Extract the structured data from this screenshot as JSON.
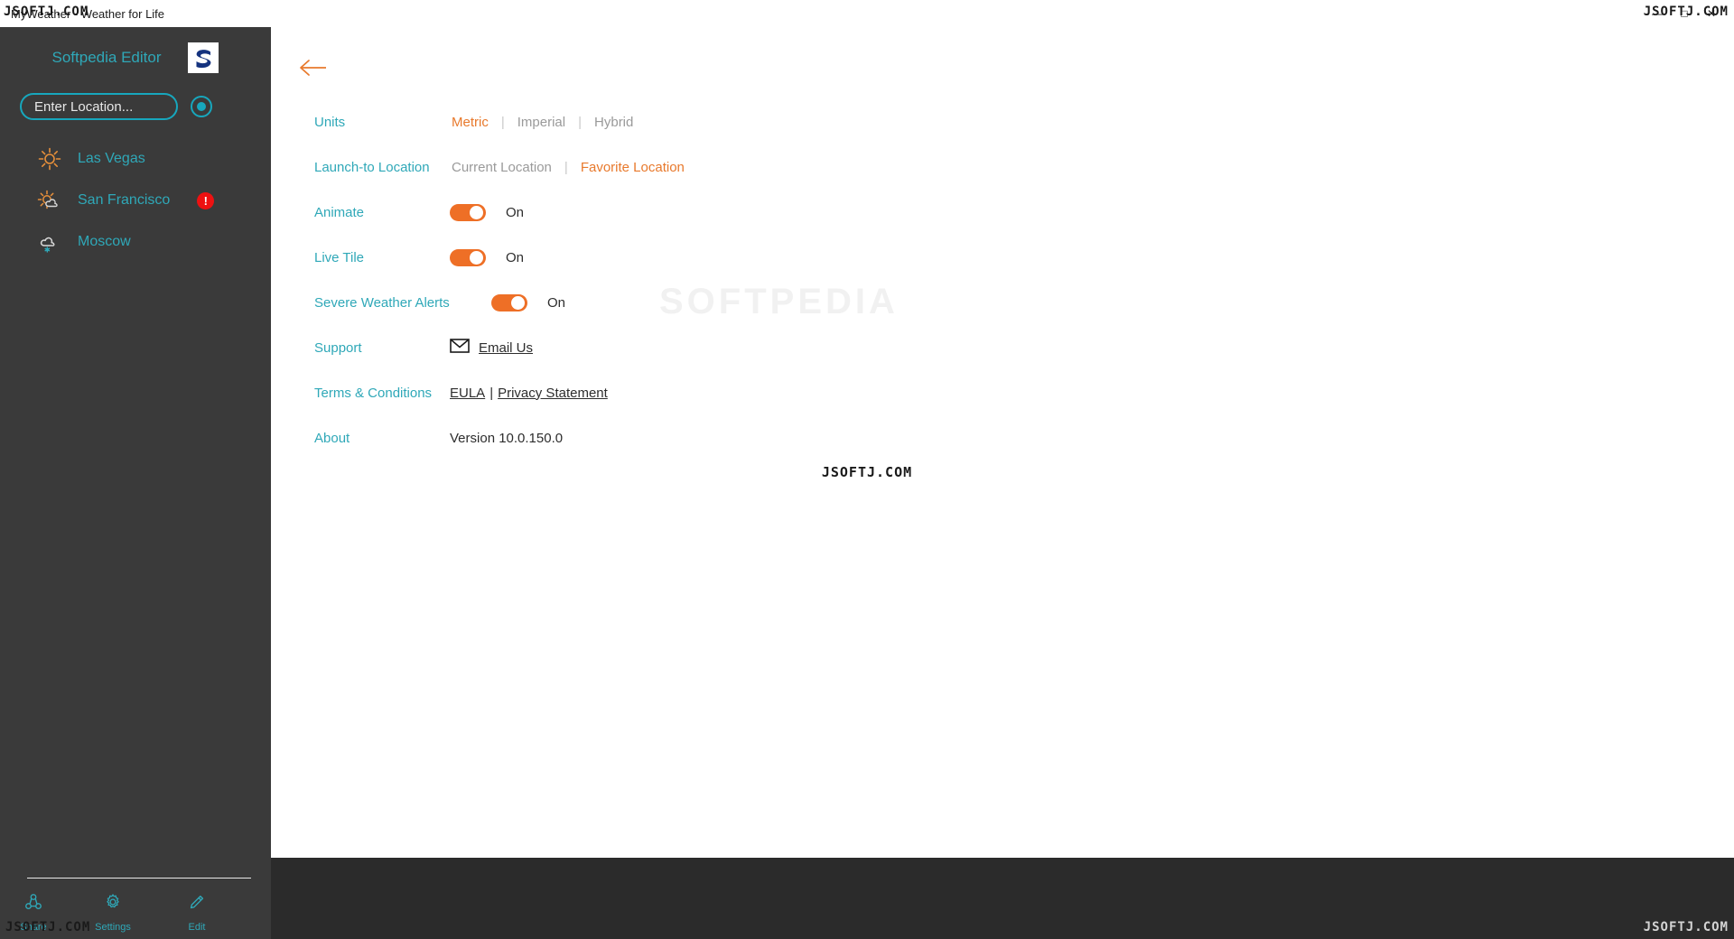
{
  "window": {
    "title": "MyWeather - Weather for Life",
    "controls": [
      {
        "name": "minimize",
        "glyph": "—"
      },
      {
        "name": "maximize",
        "glyph": "□"
      },
      {
        "name": "close",
        "glyph": "✕"
      }
    ]
  },
  "watermarks": {
    "top_left": "JSOFTJ.COM",
    "top_right": "JSOFTJ.COM",
    "center": "JSOFTJ.COM",
    "bottom_left": "JSOFTJ.COM",
    "bottom_right": "JSOFTJ.COM",
    "overlay_large": "SOFTPEDIA"
  },
  "sidebar": {
    "editor_label": "Softpedia Editor",
    "logo_letter": "S",
    "search": {
      "placeholder": "Enter Location...",
      "value": ""
    },
    "locate_button_name": "use-current-location",
    "locations": [
      {
        "name": "Las Vegas",
        "icon": "sun-icon",
        "alert": false,
        "alert_glyph": ""
      },
      {
        "name": "San Francisco",
        "icon": "sun-behind-cloud-icon",
        "alert": true,
        "alert_glyph": "!"
      },
      {
        "name": "Moscow",
        "icon": "cloud-snow-icon",
        "alert": false,
        "alert_glyph": ""
      }
    ],
    "commands": [
      {
        "label": "Share",
        "icon": "share-icon"
      },
      {
        "label": "Settings",
        "icon": "gear-icon"
      },
      {
        "label": "Edit",
        "icon": "pencil-icon"
      }
    ]
  },
  "settings": {
    "back_button_name": "back-arrow",
    "units": {
      "label": "Units",
      "options": [
        "Metric",
        "Imperial",
        "Hybrid"
      ],
      "selected": "Metric"
    },
    "launch_location": {
      "label": "Launch-to Location",
      "options": [
        "Current Location",
        "Favorite Location"
      ],
      "selected": "Favorite Location"
    },
    "animate": {
      "label": "Animate",
      "state": "On",
      "on": true
    },
    "live_tile": {
      "label": "Live Tile",
      "state": "On",
      "on": true
    },
    "severe_alerts": {
      "label": "Severe Weather Alerts",
      "state": "On",
      "on": true
    },
    "support": {
      "label": "Support",
      "link": "Email Us",
      "icon": "envelope-icon"
    },
    "terms": {
      "label": "Terms & Conditions",
      "links": [
        "EULA",
        "Privacy Statement"
      ],
      "separator": "|"
    },
    "about": {
      "label": "About",
      "value": "Version 10.0.150.0"
    }
  },
  "colors": {
    "accent_orange": "#ee6f26",
    "accent_teal": "#2fa8b8",
    "sidebar_bg": "#3a3a3a",
    "panel_bg": "#ffffff",
    "alert_red": "#ee1111"
  }
}
